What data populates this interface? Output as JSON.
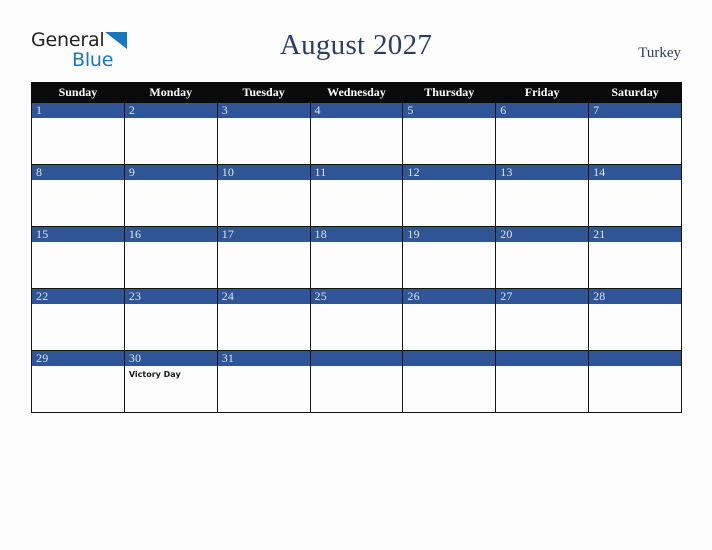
{
  "brand": {
    "name_part1": "General",
    "name_part2": "Blue",
    "triangle_icon": "blue-triangle-icon",
    "color_dark": "#221f1f",
    "color_blue": "#1b76bd"
  },
  "header": {
    "title": "August 2027",
    "month": "August",
    "year": "2027",
    "country": "Turkey",
    "title_color": "#2a3e63"
  },
  "theme": {
    "page_background": "#fdfdfd",
    "dow_header_background": "#0a0a0a",
    "dow_header_text": "#ffffff",
    "daynum_bar_background": "#2f5597",
    "daynum_text": "#dfe3ea",
    "cell_border": "#141414",
    "cell_background": "#fdfdfd",
    "event_text": "#1a1a1a"
  },
  "day_headers": [
    "Sunday",
    "Monday",
    "Tuesday",
    "Wednesday",
    "Thursday",
    "Friday",
    "Saturday"
  ],
  "weeks": [
    [
      {
        "day": "1",
        "event": ""
      },
      {
        "day": "2",
        "event": ""
      },
      {
        "day": "3",
        "event": ""
      },
      {
        "day": "4",
        "event": ""
      },
      {
        "day": "5",
        "event": ""
      },
      {
        "day": "6",
        "event": ""
      },
      {
        "day": "7",
        "event": ""
      }
    ],
    [
      {
        "day": "8",
        "event": ""
      },
      {
        "day": "9",
        "event": ""
      },
      {
        "day": "10",
        "event": ""
      },
      {
        "day": "11",
        "event": ""
      },
      {
        "day": "12",
        "event": ""
      },
      {
        "day": "13",
        "event": ""
      },
      {
        "day": "14",
        "event": ""
      }
    ],
    [
      {
        "day": "15",
        "event": ""
      },
      {
        "day": "16",
        "event": ""
      },
      {
        "day": "17",
        "event": ""
      },
      {
        "day": "18",
        "event": ""
      },
      {
        "day": "19",
        "event": ""
      },
      {
        "day": "20",
        "event": ""
      },
      {
        "day": "21",
        "event": ""
      }
    ],
    [
      {
        "day": "22",
        "event": ""
      },
      {
        "day": "23",
        "event": ""
      },
      {
        "day": "24",
        "event": ""
      },
      {
        "day": "25",
        "event": ""
      },
      {
        "day": "26",
        "event": ""
      },
      {
        "day": "27",
        "event": ""
      },
      {
        "day": "28",
        "event": ""
      }
    ],
    [
      {
        "day": "29",
        "event": ""
      },
      {
        "day": "30",
        "event": "Victory Day"
      },
      {
        "day": "31",
        "event": ""
      },
      {
        "day": "",
        "event": ""
      },
      {
        "day": "",
        "event": ""
      },
      {
        "day": "",
        "event": ""
      },
      {
        "day": "",
        "event": ""
      }
    ]
  ]
}
